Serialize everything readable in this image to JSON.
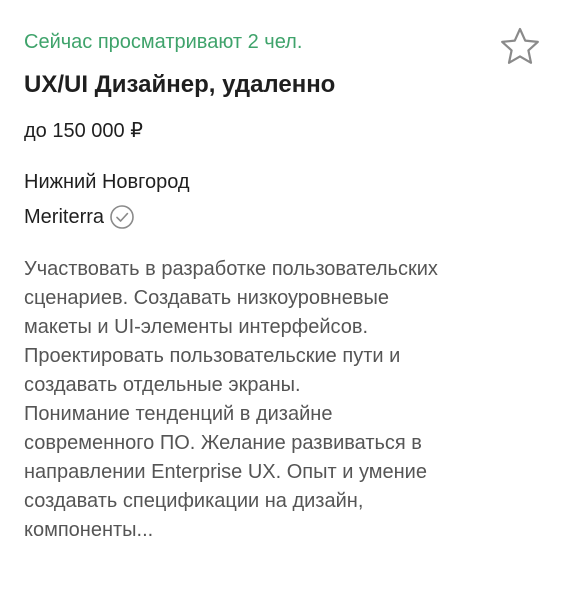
{
  "vacancy": {
    "viewers": "Сейчас просматривают 2 чел.",
    "title": "UX/UI Дизайнер, удаленно",
    "salary": "до 150 000 ₽",
    "city": "Нижний Новгород",
    "company": "Meriterra",
    "description_lines": [
      "Участвовать в разработке пользовательских",
      "сценариев. Создавать низкоуровневые",
      "макеты и UI-элементы интерфейсов.",
      "Проектировать пользовательские пути и",
      "создавать отдельные экраны.",
      "Понимание тенденций в дизайне",
      "современного ПО. Желание развиваться в",
      "направлении Enterprise UX. Опыт и умение",
      "создавать спецификации на дизайн,",
      "компоненты..."
    ]
  },
  "icons": {
    "favorite": "star-outline-icon",
    "verified": "check-circle-icon"
  },
  "colors": {
    "accent_green": "#3fa36b",
    "text_primary": "#1f1f1f",
    "text_secondary": "#555555",
    "icon_gray": "#8a8a8a"
  }
}
